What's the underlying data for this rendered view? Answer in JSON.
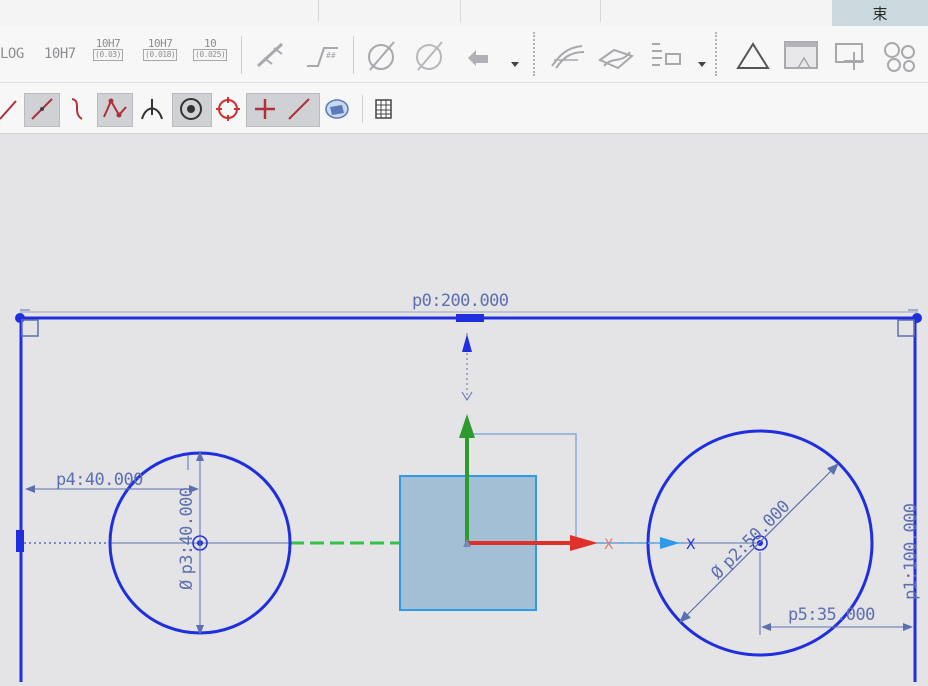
{
  "tabs": {
    "finish_label": "束"
  },
  "toolbar1": {
    "tol_log": "LOG",
    "tol_hole": "10H7",
    "tol_upper": "10H7",
    "tol_upper_sub": "(0.03)",
    "tol_lower": "10H7",
    "tol_lower_sub": "(0.018)",
    "tol_plain": "10",
    "tol_plain_sub": "(0.025)"
  },
  "sketch": {
    "dims": {
      "p0": "p0:200.000",
      "p1": "p1:100.000",
      "p2": "p2:50.000",
      "p3": "p3:40.000",
      "p4": "p4:40.000",
      "p5": "p5:35.000"
    },
    "diameter_symbol": "Ø",
    "axis_x_marker": "X"
  },
  "colors": {
    "sketch_blue": "#1f2fe0",
    "dim_blue": "#5d6fb0",
    "axis_green": "#2c9a2c",
    "axis_red": "#e0302a",
    "square_fill": "#a3bfd6",
    "square_stroke": "#2f9be8"
  },
  "icons": [
    "sketch-line-icon",
    "sketch-line-icon",
    "tangent-curve-icon",
    "spline-icon",
    "intersection-icon",
    "circle-center-snap-icon",
    "quadrant-point-icon",
    "existing-point-icon",
    "point-on-curve-icon",
    "view-orient-icon",
    "spreadsheet-icon"
  ]
}
